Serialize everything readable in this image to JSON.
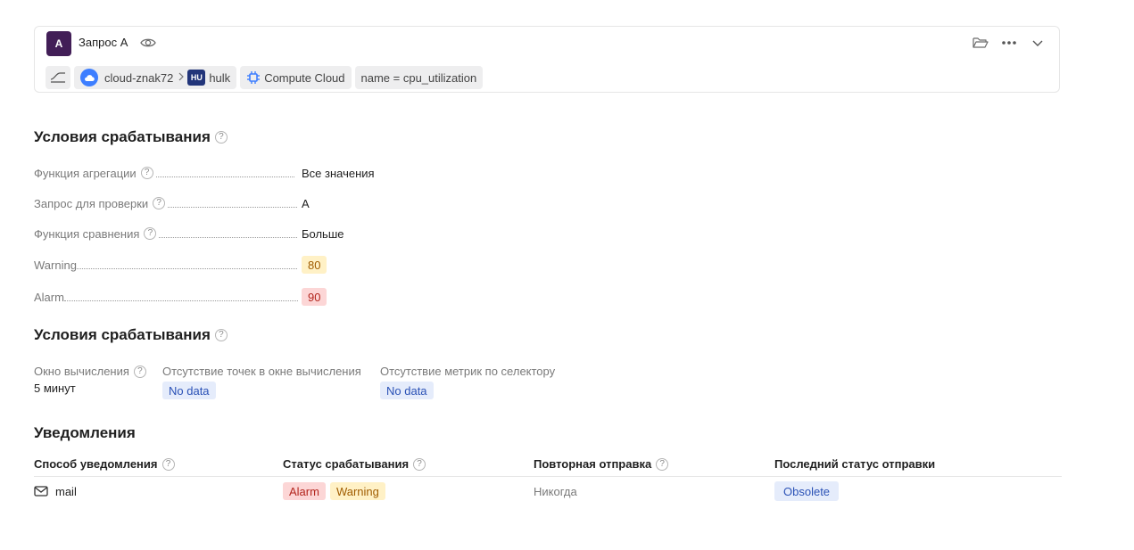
{
  "query": {
    "letter": "A",
    "title": "Запрос A",
    "chips": {
      "folder": "cloud-znak72",
      "service_badge": "HU",
      "service": "hulk",
      "resource": "Compute Cloud",
      "selector": "name = cpu_utilization"
    },
    "icons": [
      "eye-icon",
      "chart-line-icon",
      "cloud-icon",
      "gear-chip-icon",
      "folder-open-icon",
      "more-icon",
      "chevron-down-icon"
    ]
  },
  "trigger": {
    "title": "Условия срабатывания",
    "rows": [
      {
        "label": "Функция агрегации",
        "value": "Все значения",
        "help": true
      },
      {
        "label": "Запрос для проверки",
        "value": "A",
        "help": true
      },
      {
        "label": "Функция сравнения",
        "value": "Больше",
        "help": true
      },
      {
        "label": "Warning",
        "value": "80",
        "help": false
      },
      {
        "label": "Alarm",
        "value": "90",
        "help": false
      }
    ]
  },
  "conditions": {
    "title": "Условия срабатывания",
    "window_label": "Окно вычисления",
    "window_value": "5 минут",
    "no_points_label": "Отсутствие точек в окне вычисления",
    "no_points_value": "No data",
    "no_metrics_label": "Отсутствие метрик по селектору",
    "no_metrics_value": "No data"
  },
  "notifications": {
    "title": "Уведомления",
    "columns": [
      "Способ уведомления",
      "Статус срабатывания",
      "Повторная отправка",
      "Последний статус отправки"
    ],
    "row": {
      "method": "mail",
      "statuses": [
        "Alarm",
        "Warning"
      ],
      "repeat": "Никогда",
      "last_status": "Obsolete"
    }
  },
  "help_glyph": "?",
  "colors": {
    "accent_avatar": "#421e57",
    "warning_bg": "#fff1c6",
    "alarm_bg": "#fcd6d6",
    "nodata_bg": "#e5ecfb"
  }
}
